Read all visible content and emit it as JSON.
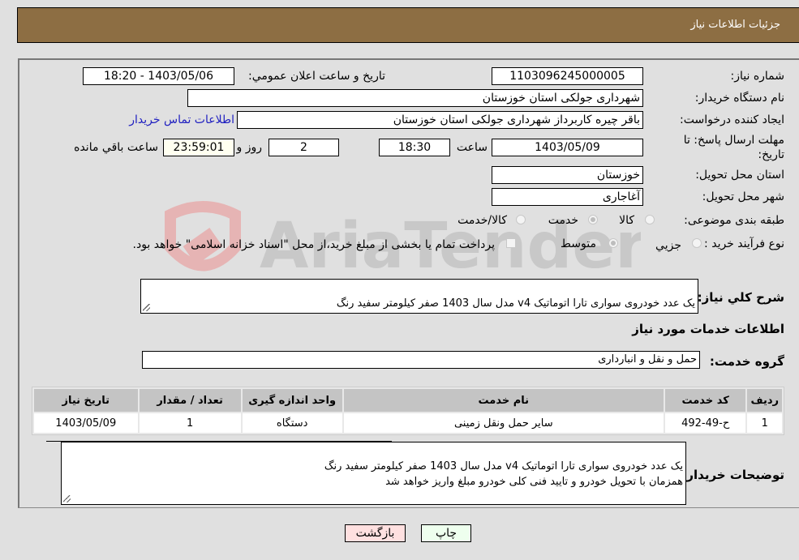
{
  "header": {
    "title": "جزئیات اطلاعات نیاز"
  },
  "form": {
    "need_number": {
      "label": "شماره نیاز:",
      "value": "1103096245000005"
    },
    "announce_datetime": {
      "label": "تاریخ و ساعت اعلان عمومي:",
      "value": "1403/05/06 - 18:20"
    },
    "buyer_org": {
      "label": "نام دستگاه خریدار:",
      "value": "شهرداری جولکی استان خوزستان"
    },
    "creator": {
      "label": "ایجاد کننده درخواست:",
      "value": "باقر چیره کاربرداز شهرداری جولکی استان خوزستان",
      "contact_link": "اطلاعات تماس خریدار"
    },
    "deadline": {
      "label_line1": "مهلت ارسال پاسخ: تا",
      "label_line2": "تاریخ:",
      "date": "1403/05/09",
      "time_label": "ساعت",
      "time": "18:30",
      "days": "2",
      "days_label": "روز و",
      "remaining": "23:59:01",
      "remaining_label": "ساعت باقي مانده"
    },
    "province": {
      "label": "استان محل تحویل:",
      "value": "خوزستان"
    },
    "city": {
      "label": "شهر محل تحویل:",
      "value": "آغاجاری"
    },
    "category": {
      "label": "طبقه بندی موضوعی:",
      "options": [
        "کالا",
        "خدمت",
        "کالا/خدمت"
      ],
      "selected": "خدمت"
    },
    "purchase_type": {
      "label": "نوع فرآیند خرید :",
      "options": [
        "جزيي",
        "متوسط"
      ],
      "selected": "متوسط",
      "treasury_note": "پرداخت تمام یا بخشی از مبلغ خرید،از محل \"اسناد خزانه اسلامی\" خواهد بود.",
      "treasury_checked": false
    },
    "general_description": {
      "label": "شرح کلي نیاز:",
      "value": "یک عدد خودروی سواری تارا  اتوماتیک v4  مدل سال 1403  صفر کیلومتر سفید رنگ\nهمزمان با تحویل خودرو  و تایید فنی  کلی خودرو مبلغ واریز خواهد شد"
    }
  },
  "services": {
    "section_title": "اطلاعات خدمات مورد نیاز",
    "group_label": "گروه خدمت:",
    "group_value": "حمل و نقل و انبارداری",
    "columns": [
      "ردیف",
      "کد خدمت",
      "نام خدمت",
      "واحد اندازه گیری",
      "تعداد / مقدار",
      "تاریخ نیاز"
    ],
    "rows": [
      [
        "1",
        "ح-49-492",
        "سایر حمل ونقل زمینی",
        "دستگاه",
        "1",
        "1403/05/09"
      ]
    ]
  },
  "buyer_notes": {
    "label": "توضیحات خریدار:",
    "value": "یک عدد خودروی سواری تارا  اتوماتیک v4  مدل سال 1403  صفر کیلومتر سفید رنگ\nهمزمان با تحویل خودرو  و تایید فنی  کلی خودرو مبلغ واریز خواهد شد"
  },
  "buttons": {
    "print": "چاپ",
    "back": "بازگشت"
  },
  "colors": {
    "header_bg": "#8d6e43",
    "print_bg": "#eeffee",
    "back_bg": "#ffe0e0",
    "link": "#2020c0"
  }
}
